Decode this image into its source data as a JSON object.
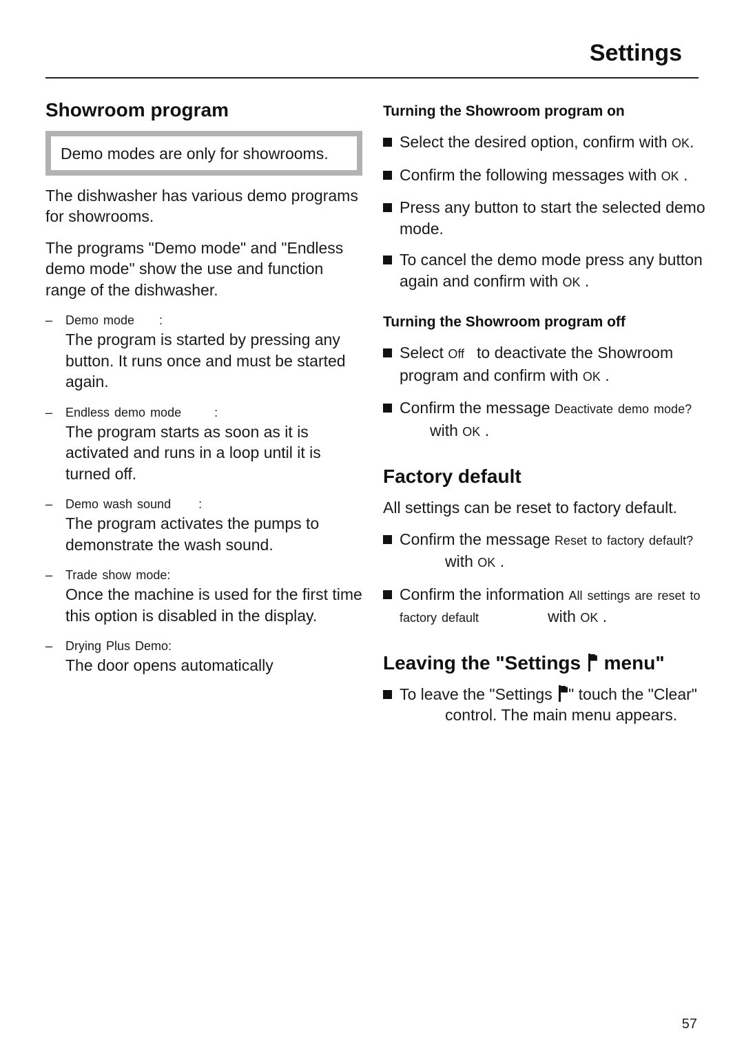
{
  "header": {
    "title": "Settings",
    "page_number": "57"
  },
  "showroom": {
    "heading": "Showroom program",
    "note": "Demo modes are  only for showrooms.",
    "intro_1": "The dishwasher has various demo programs for showrooms.",
    "intro_2": "The programs \"Demo mode\" and \"Endless demo mode\" show the use and function range of the dishwasher.",
    "modes": [
      {
        "label": "Demo mode",
        "suffix": ":",
        "description": "The program is started by pressing any button. It runs once and must be started again."
      },
      {
        "label": "Endless demo mode",
        "suffix": ":",
        "description": "The program starts as soon as it is activated and runs in a loop until it is turned off."
      },
      {
        "label": "Demo wash sound",
        "suffix": ":",
        "description": "The program activates the pumps to demonstrate the wash sound."
      },
      {
        "label": "Trade show mode:",
        "suffix": "",
        "description": "Once the machine is used for the first time this option is disabled in the display."
      },
      {
        "label": "Drying Plus Demo:",
        "suffix": "",
        "description": "The door opens automatically"
      }
    ]
  },
  "turning_on": {
    "heading": "Turning the Showroom program on",
    "steps": [
      {
        "before": "Select the desired option, confirm with ",
        "code": "OK",
        "after": "."
      },
      {
        "before": "Confirm the following messages with ",
        "code": "OK",
        "after": " ."
      },
      {
        "before": "Press any button to start the selected demo mode.",
        "code": "",
        "after": ""
      },
      {
        "before": "To cancel the demo mode press any button again and confirm with ",
        "code": "OK",
        "after": " ."
      }
    ]
  },
  "turning_off": {
    "heading": "Turning the Showroom program off",
    "step1": {
      "before": "Select ",
      "code": "Off",
      "after": "to deactivate the Showroom program and confirm with ",
      "ok": "OK",
      "end": " ."
    },
    "step2": {
      "before": "Confirm the message ",
      "code": "Deactivate demo mode?",
      "after": "with ",
      "ok": "OK",
      "end": " ."
    }
  },
  "factory_default": {
    "heading": "Factory default",
    "intro": "All settings can be reset to factory default.",
    "step1": {
      "before": "Confirm the message ",
      "code": "Reset to factory default?",
      "after": "with ",
      "ok": "OK",
      "end": " ."
    },
    "step2": {
      "before": "Confirm the information ",
      "code": "All settings are reset to factory default",
      "after": "with ",
      "ok": "OK",
      "end": " ."
    }
  },
  "leaving": {
    "heading_before": "Leaving the \"Settings ",
    "heading_after": " menu\"",
    "icon": "flag-icon",
    "step_before": "To leave the \"Settings ",
    "step_middle": "\" touch the \"Clear\"",
    "step_after": "control. The main menu appears."
  }
}
